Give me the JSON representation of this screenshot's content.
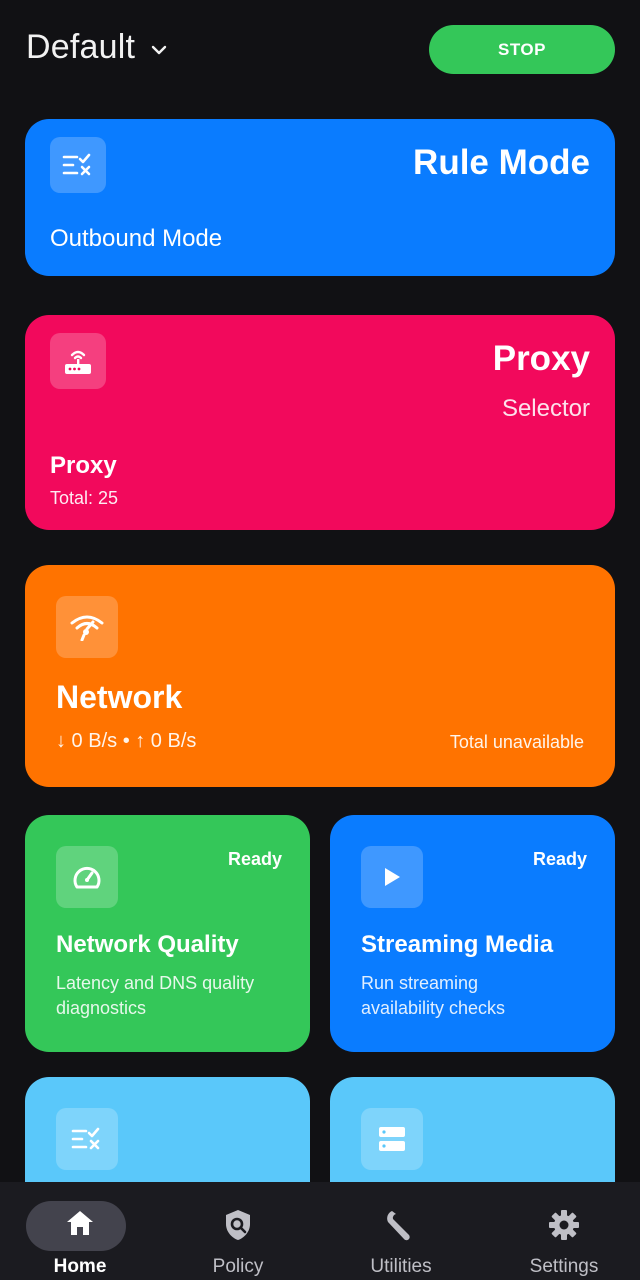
{
  "header": {
    "profile_name": "Default",
    "stop_label": "STOP",
    "stop_color": "#34c759"
  },
  "mode_card": {
    "title": "Rule Mode",
    "subtitle": "Outbound Mode",
    "color": "#0a7cff",
    "icon": "rule-list-icon"
  },
  "proxy_card": {
    "title": "Proxy",
    "type": "Selector",
    "group": "Proxy",
    "total": "Total: 25",
    "color": "#f2095c",
    "icon": "router-icon"
  },
  "network_card": {
    "title": "Network",
    "speed": "↓ 0 B/s • ↑ 0 B/s",
    "total": "Total unavailable",
    "color": "#ff7300",
    "icon": "wifi-signal-icon"
  },
  "quality_card": {
    "status": "Ready",
    "title": "Network Quality",
    "desc": "Latency and DNS quality diagnostics",
    "color": "#34c759",
    "icon": "speedometer-icon"
  },
  "streaming_card": {
    "status": "Ready",
    "title": "Streaming Media",
    "desc": "Run streaming availability checks",
    "color": "#0a7cff",
    "icon": "play-icon"
  },
  "extra_cards": [
    {
      "icon": "rule-list-icon",
      "color": "#5ac8fa"
    },
    {
      "icon": "server-icon",
      "color": "#5ac8fa"
    }
  ],
  "nav": [
    {
      "label": "Home",
      "icon": "home-icon",
      "active": true
    },
    {
      "label": "Policy",
      "icon": "shield-search-icon",
      "active": false
    },
    {
      "label": "Utilities",
      "icon": "wrench-icon",
      "active": false
    },
    {
      "label": "Settings",
      "icon": "gear-icon",
      "active": false
    }
  ]
}
